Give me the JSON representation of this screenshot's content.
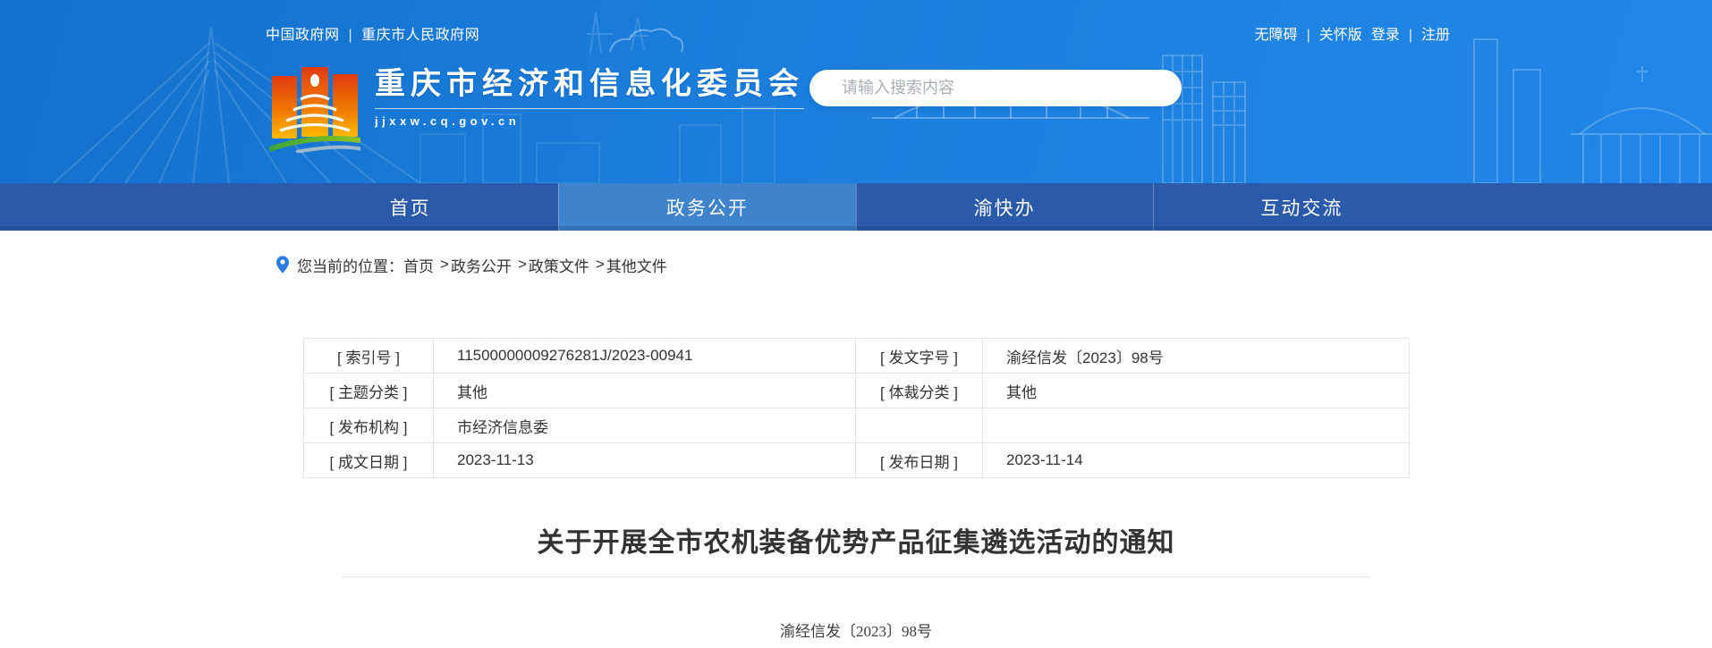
{
  "header": {
    "gov_links": [
      "中国政府网",
      "重庆市人民政府网"
    ],
    "quick_links": [
      "无障碍",
      "关怀版",
      "登录",
      "注册"
    ],
    "link_separator": "|",
    "site_title": "重庆市经济和信息化委员会",
    "site_url": "jjxxw.cq.gov.cn",
    "search_placeholder": "请输入搜索内容"
  },
  "nav": {
    "items": [
      {
        "label": "首页"
      },
      {
        "label": "政务公开"
      },
      {
        "label": "渝快办"
      },
      {
        "label": "互动交流"
      }
    ]
  },
  "breadcrumb": {
    "prefix": "您当前的位置：",
    "separator": ">",
    "items": [
      "首页",
      "政务公开",
      "政策文件",
      "其他文件"
    ]
  },
  "doc_meta": {
    "rows": [
      {
        "label1": "[ 索引号 ]",
        "value1": "11500000009276281J/2023-00941",
        "label2": "[ 发文字号 ]",
        "value2": "渝经信发〔2023〕98号"
      },
      {
        "label1": "[ 主题分类 ]",
        "value1": "其他",
        "label2": "[ 体裁分类 ]",
        "value2": "其他"
      },
      {
        "label1": "[ 发布机构 ]",
        "value1": "市经济信息委",
        "label2": "",
        "value2": ""
      },
      {
        "label1": "[ 成文日期 ]",
        "value1": "2023-11-13",
        "label2": "[ 发布日期 ]",
        "value2": "2023-11-14"
      }
    ]
  },
  "article": {
    "title": "关于开展全市农机装备优势产品征集遴选活动的通知",
    "doc_number": "渝经信发〔2023〕98号"
  },
  "colors": {
    "banner_blue": "#1b7edd",
    "nav_blue": "#2a5aa9",
    "nav_active_blue": "#3e83cb",
    "logo_red": "#e23a10",
    "logo_yellow": "#fdb900",
    "logo_green": "#56b030"
  }
}
